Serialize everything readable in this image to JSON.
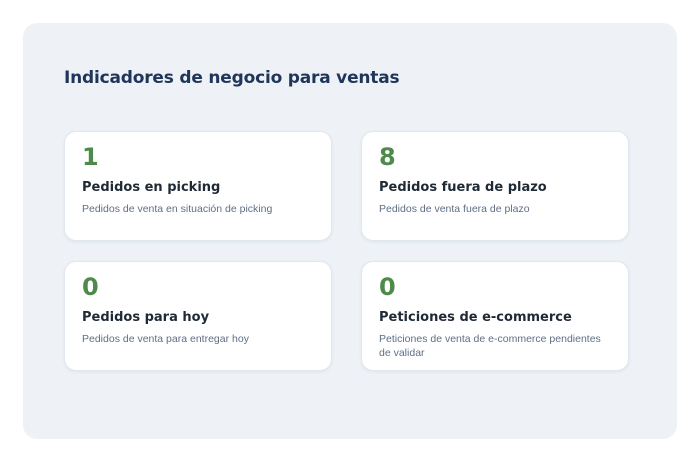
{
  "section": {
    "title": "Indicadores de negocio para ventas"
  },
  "cards": [
    {
      "value": "1",
      "title": "Pedidos en picking",
      "description": "Pedidos de venta en situación de picking"
    },
    {
      "value": "8",
      "title": "Pedidos fuera de plazo",
      "description": "Pedidos de venta fuera de plazo"
    },
    {
      "value": "0",
      "title": "Pedidos para hoy",
      "description": "Pedidos de venta para entregar hoy"
    },
    {
      "value": "0",
      "title": "Peticiones de e-commerce",
      "description": "Peticiones de venta de e-commerce pendientes de validar"
    }
  ],
  "colors": {
    "panel_background": "#eef2f7",
    "title": "#1f3559",
    "kpi_value": "#4e8a4b",
    "card_title": "#1f2a37",
    "card_description": "#5f6f85"
  }
}
